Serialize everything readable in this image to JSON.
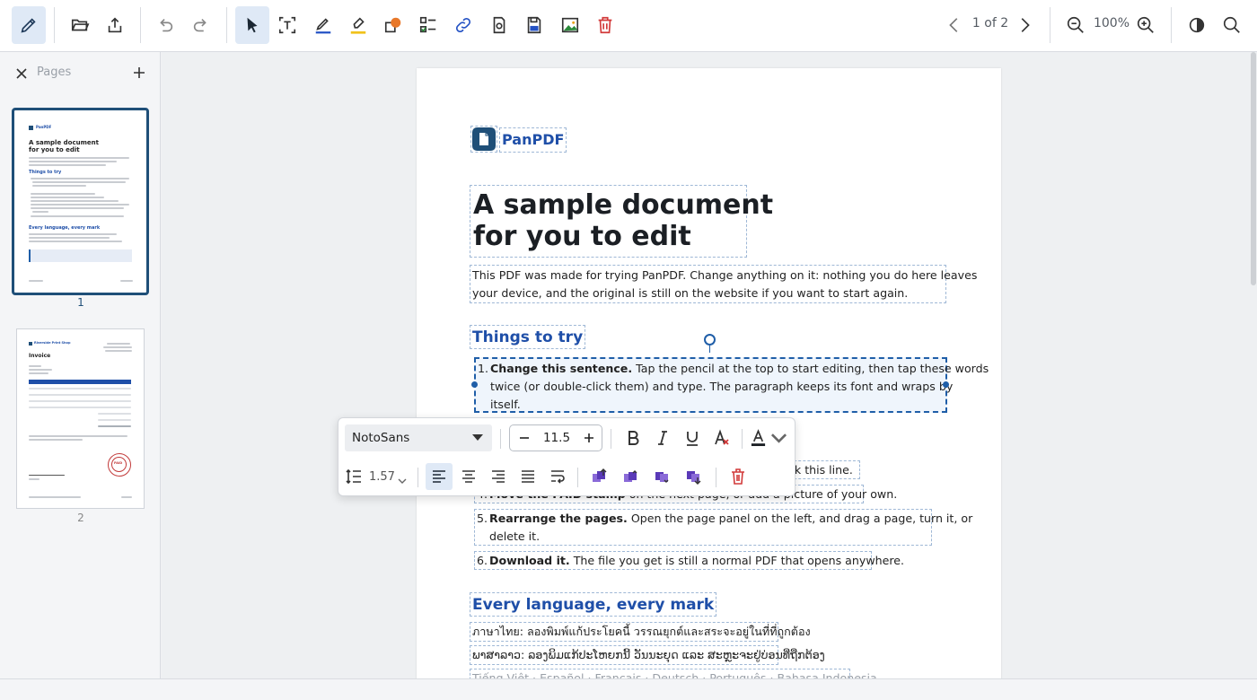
{
  "toolbar": {
    "page_indicator": "1 of 2",
    "zoom": "100%",
    "tools": [
      "edit-pencil-icon",
      "open-folder-icon",
      "export-icon",
      "undo-icon",
      "redo-icon",
      "select-cursor-icon",
      "text-box-icon",
      "draw-pen-icon",
      "highlighter-icon",
      "shapes-icon",
      "form-fields-icon",
      "link-icon",
      "stamp-icon",
      "save-page-icon",
      "image-icon",
      "delete-icon",
      "prev-page-icon",
      "next-page-icon",
      "zoom-out-icon",
      "zoom-in-icon",
      "contrast-icon",
      "search-icon"
    ]
  },
  "sidebar": {
    "title": "Pages",
    "pages": [
      {
        "number": "1"
      },
      {
        "number": "2"
      }
    ],
    "thumb1": {
      "brand": "PanPDF",
      "title_line1": "A sample document",
      "title_line2": "for you to edit",
      "heading1": "Things to try",
      "heading2": "Every language, every mark"
    },
    "thumb2": {
      "brand": "Riverside Print Shop",
      "title": "Invoice",
      "stamp": "PAID"
    }
  },
  "document": {
    "brand": "PanPDF",
    "title_line1": "A sample document",
    "title_line2": "for you to edit",
    "intro_line1": "This PDF was made for trying PanPDF. Change anything on it: nothing you do here leaves",
    "intro_line2": "your device, and the original is still on the website if you want to start again.",
    "section1": "Things to try",
    "items": [
      {
        "num": "1.",
        "bold": "Change this sentence.",
        "line1": " Tap the pencil at the top to start editing, then tap these words",
        "line2": "twice (or double-click them) and type. The paragraph keeps its font and wraps by",
        "line3": "itself."
      },
      {
        "tail": "ark this line."
      },
      {
        "num": "4.",
        "bold": "Move the PAID stamp",
        "line1": " on the next page, or add a picture of your own."
      },
      {
        "num": "5.",
        "bold": "Rearrange the pages.",
        "line1": " Open the page panel on the left, and drag a page, turn it, or",
        "line2": "delete it."
      },
      {
        "num": "6.",
        "bold": "Download it.",
        "line1": " The file you get is still a normal PDF that opens anywhere."
      }
    ],
    "section2": "Every language, every mark",
    "lang_thai": "ภาษาไทย: ลองพิมพ์แก้ประโยคนี้ วรรณยุกต์และสระจะอยู่ในที่ที่ถูกต้อง",
    "lang_lao": "ພາສາລາວ: ລອງພິມແກ້ປະໂຫຍກນີ້ ວັນນະຍຸດ ແລະ ສະຫຼະຈະຢູ່ບ່ອນທີ່ຖືກຕ້ອງ",
    "lang_list": "Tiếng Việt · Español · Français · Deutsch · Português · Bahasa Indonesia"
  },
  "format_popup": {
    "font": "NotoSans",
    "size": "11.5",
    "line_height": "1.57",
    "text_color": "#1b1f24"
  }
}
